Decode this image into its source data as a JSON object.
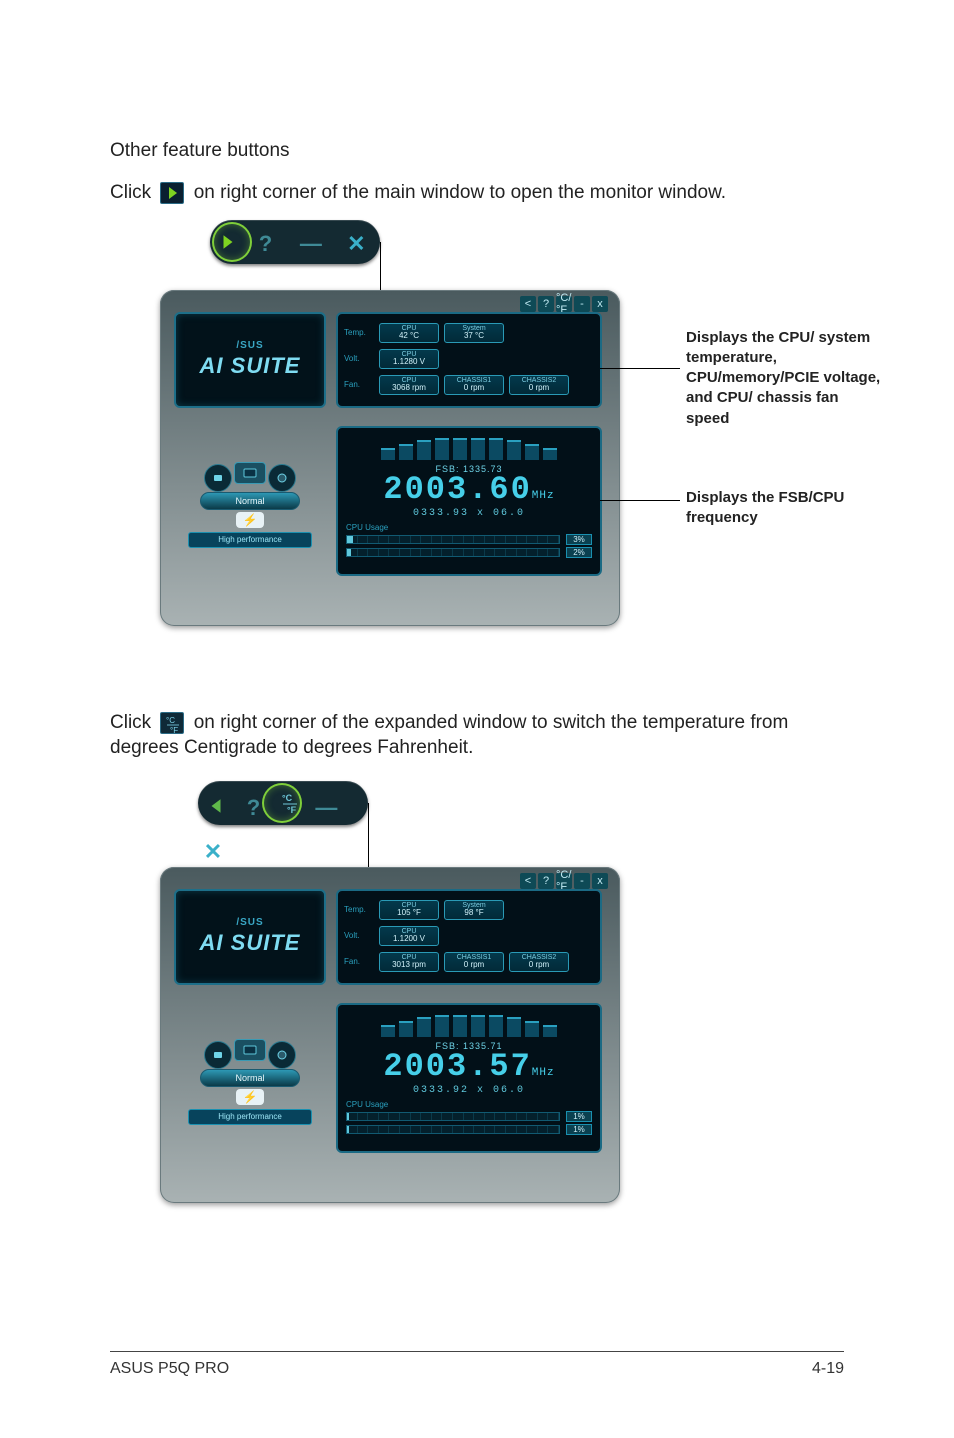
{
  "heading": "Other feature buttons",
  "para1_pre": "Click ",
  "para1_post": " on right corner of the main window to open the monitor window.",
  "para2_pre": "Click ",
  "para2_post": " on right corner of the expanded window to switch the temperature from degrees Centigrade to degrees Fahrenheit.",
  "callout1": "Displays the CPU/ system temperature, CPU/memory/PCIE voltage, and CPU/ chassis fan speed",
  "callout2": "Displays the FSB/CPU frequency",
  "brand_small": "/SUS",
  "brand_big": "AI SUITE",
  "perf_center": "",
  "perf_bar": "Normal",
  "perf_label": "High performance",
  "mini_ctl": [
    "<",
    "?",
    "°C/°F",
    "-",
    "x"
  ],
  "sensor_rows": {
    "temp_label": "Temp.",
    "volt_label": "Volt.",
    "fan_label": "Fan."
  },
  "fig1": {
    "temp_cpu_h": "CPU",
    "temp_cpu_v": "42 °C",
    "temp_sys_h": "System",
    "temp_sys_v": "37 °C",
    "volt_cpu_h": "CPU",
    "volt_cpu_v": "1.1280 V",
    "fan_cpu_h": "CPU",
    "fan_cpu_v": "3068 rpm",
    "fan_ch1_h": "CHASSIS1",
    "fan_ch1_v": "0 rpm",
    "fan_ch2_h": "CHASSIS2",
    "fan_ch2_v": "0 rpm",
    "fsb": "FSB: 1335.73",
    "big": "2003.60",
    "unit": "MHz",
    "sub": "0333.93 x 06.0",
    "usage_label": "CPU Usage",
    "usage": [
      "3%",
      "2%"
    ]
  },
  "fig2": {
    "temp_cpu_h": "CPU",
    "temp_cpu_v": "105 °F",
    "temp_sys_h": "System",
    "temp_sys_v": "98 °F",
    "volt_cpu_h": "CPU",
    "volt_cpu_v": "1.1200 V",
    "fan_cpu_h": "CPU",
    "fan_cpu_v": "3013 rpm",
    "fan_ch1_h": "CHASSIS1",
    "fan_ch1_v": "0 rpm",
    "fan_ch2_h": "CHASSIS2",
    "fan_ch2_v": "0 rpm",
    "fsb": "FSB: 1335.71",
    "big": "2003.57",
    "unit": "MHz",
    "sub": "0333.92 x 06.0",
    "usage_label": "CPU Usage",
    "usage": [
      "1%",
      "1%"
    ]
  },
  "footer_left": "ASUS P5Q PRO",
  "footer_right": "4-19"
}
